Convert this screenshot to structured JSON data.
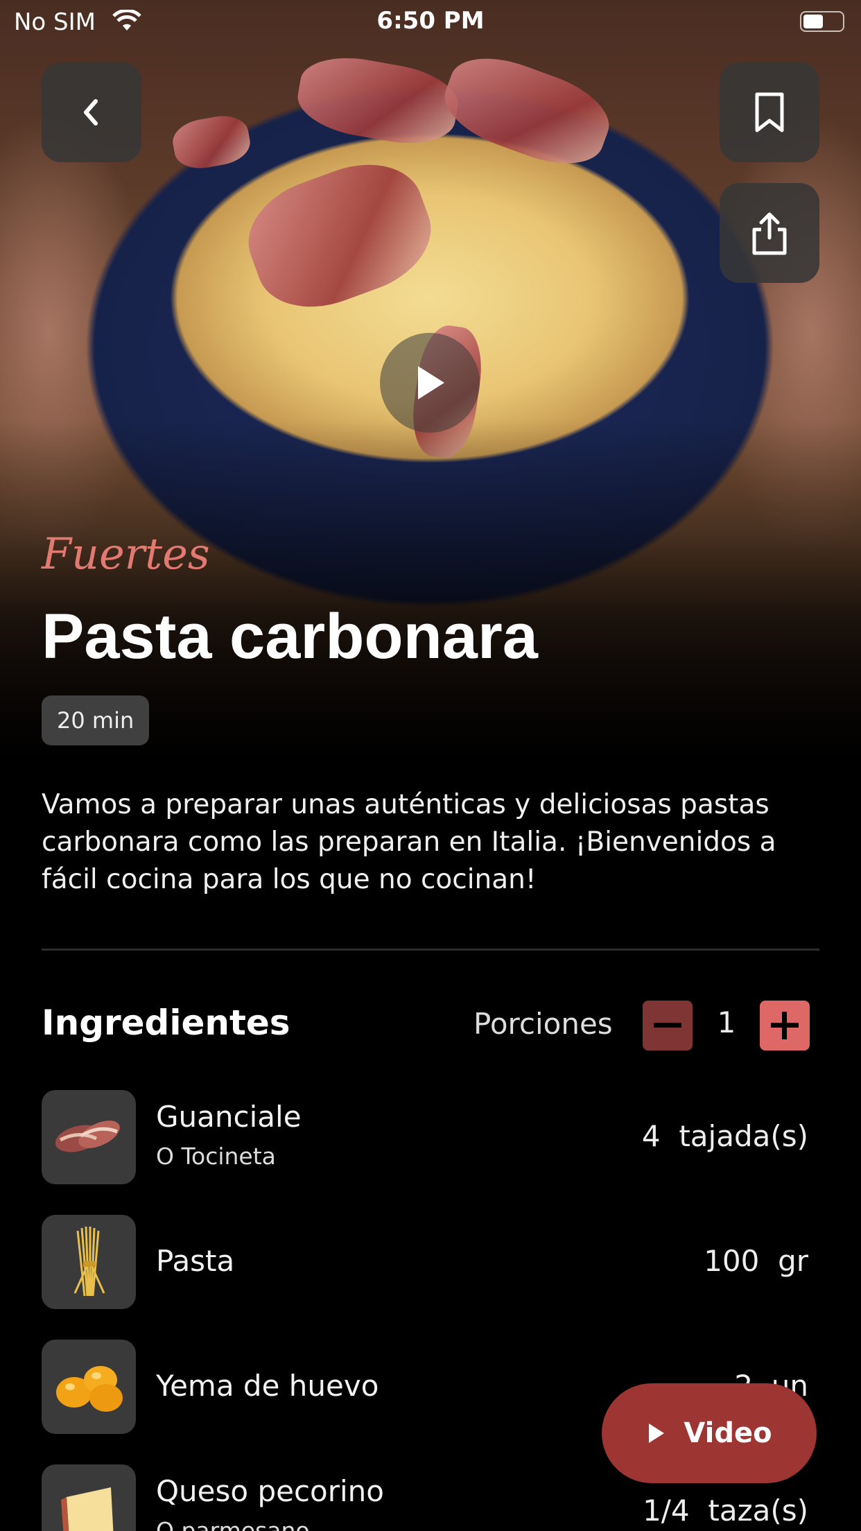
{
  "status_bar": {
    "carrier": "No SIM",
    "time": "6:50 PM"
  },
  "recipe": {
    "category": "Fuertes",
    "title": "Pasta carbonara",
    "time": "20 min",
    "description": "Vamos a preparar unas auténticas y deliciosas pastas carbonara como las preparan en Italia. ¡Bienvenidos a fácil cocina para los que no cocinan!"
  },
  "ingredients_section": {
    "title": "Ingredientes",
    "portions_label": "Porciones",
    "portions_value": "1",
    "items": [
      {
        "name": "Guanciale",
        "note": "O Tocineta",
        "qty": "4  tajada(s)",
        "icon": "bacon"
      },
      {
        "name": "Pasta",
        "note": "",
        "qty": "100  gr",
        "icon": "spaghetti"
      },
      {
        "name": "Yema de huevo",
        "note": "",
        "qty": "2  un",
        "icon": "egg-yolk"
      },
      {
        "name": "Queso pecorino",
        "note": "O parmesano",
        "qty": "1/4  taza(s)",
        "icon": "cheese"
      }
    ]
  },
  "video_button": {
    "label": "Video"
  },
  "colors": {
    "accent": "#dd6865",
    "accent_dark": "#7e3534",
    "video": "#9d3533",
    "category": "#e27a72"
  }
}
